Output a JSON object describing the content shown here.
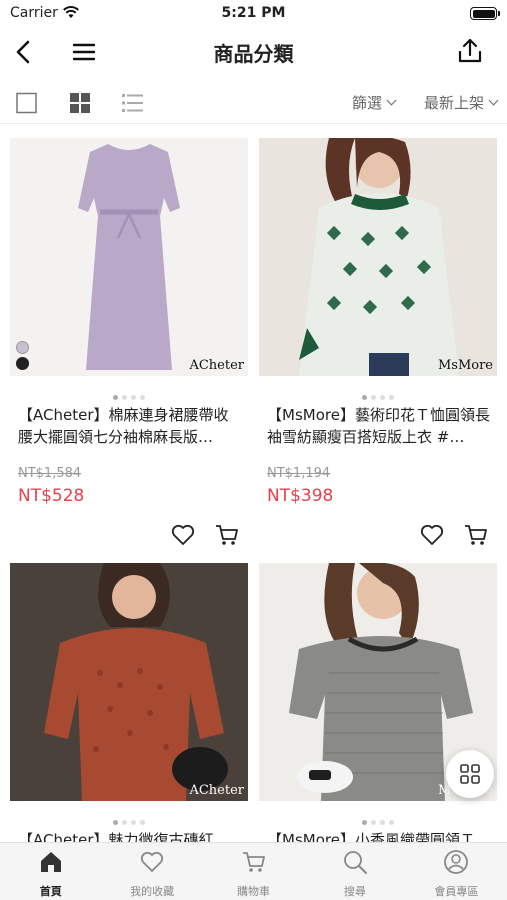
{
  "status_bar": {
    "carrier": "Carrier",
    "time": "5:21 PM"
  },
  "nav": {
    "title": "商品分類"
  },
  "toolbar": {
    "filter_label": "篩選",
    "sort_label": "最新上架"
  },
  "products": [
    {
      "brand_mark": "ACheter",
      "name": "【ACheter】棉麻連身裙腰帶收腰大擺圓領七分袖棉麻長版…",
      "original_price": "NT$1,584",
      "price": "NT$528"
    },
    {
      "brand_mark": "MsMore",
      "name": "【MsMore】藝術印花Ｔ恤圓領長袖雪紡顯瘦百搭短版上衣 #…",
      "original_price": "NT$1,194",
      "price": "NT$398"
    },
    {
      "brand_mark": "ACheter",
      "name": "【ACheter】魅力微復古磚紅水…",
      "original_price": "",
      "price": ""
    },
    {
      "brand_mark": "MsMore",
      "name": "【MsMore】小香風織帶圓領Ｔ…",
      "original_price": "",
      "price": ""
    }
  ],
  "tabs": [
    {
      "label": "首頁",
      "icon": "home-icon",
      "active": true
    },
    {
      "label": "我的收藏",
      "icon": "heart-icon",
      "active": false
    },
    {
      "label": "購物車",
      "icon": "cart-icon",
      "active": false
    },
    {
      "label": "搜尋",
      "icon": "search-icon",
      "active": false
    },
    {
      "label": "會員專區",
      "icon": "user-icon",
      "active": false
    }
  ],
  "colors": {
    "price": "#e8414b",
    "dress": "#b9a8c8",
    "sweater": "#a84a32"
  }
}
